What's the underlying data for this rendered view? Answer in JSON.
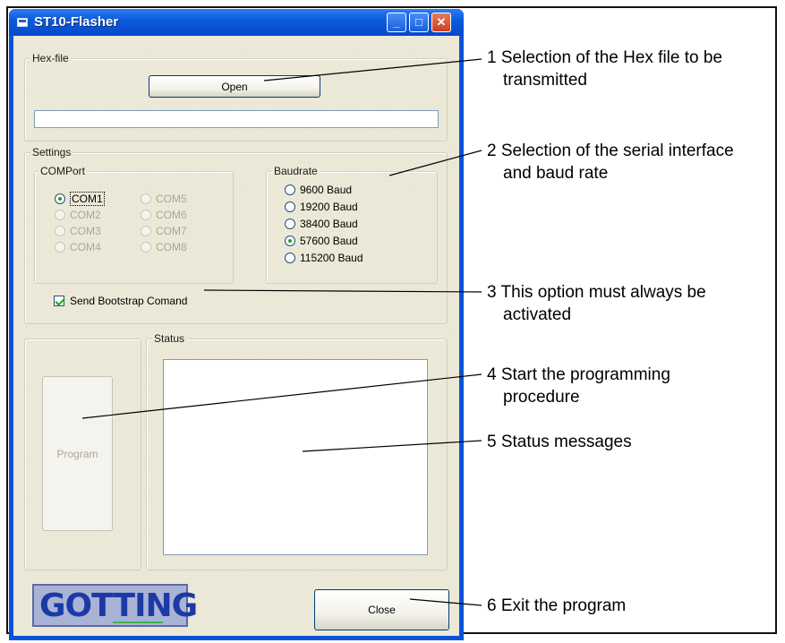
{
  "window": {
    "title": "ST10-Flasher",
    "minimize": "_",
    "maximize": "□",
    "close": "✕"
  },
  "hexfile": {
    "label": "Hex-file",
    "open_label": "Open",
    "path_value": ""
  },
  "settings": {
    "label": "Settings",
    "comport": {
      "label": "COMPort",
      "options": [
        "COM1",
        "COM2",
        "COM3",
        "COM4",
        "COM5",
        "COM6",
        "COM7",
        "COM8"
      ],
      "selected": "COM1"
    },
    "baudrate": {
      "label": "Baudrate",
      "options": [
        "9600 Baud",
        "19200 Baud",
        "38400 Baud",
        "57600 Baud",
        "115200 Baud"
      ],
      "selected": "57600 Baud"
    },
    "bootstrap_label": "Send Bootstrap Comand",
    "bootstrap_checked": true
  },
  "program": {
    "label": "Program"
  },
  "status": {
    "label": "Status",
    "messages": ""
  },
  "close_label": "Close",
  "logo_text": "GOTTING",
  "callouts": [
    {
      "num": "1",
      "text": "Selection of the Hex file to be",
      "cont": "transmitted"
    },
    {
      "num": "2",
      "text": "Selection of the serial interface",
      "cont": "and baud rate"
    },
    {
      "num": "3",
      "text": "This option must always be",
      "cont": "activated"
    },
    {
      "num": "4",
      "text": "Start the programming",
      "cont": "procedure"
    },
    {
      "num": "5",
      "text": "Status messages",
      "cont": ""
    },
    {
      "num": "6",
      "text": "Exit the program",
      "cont": ""
    }
  ]
}
